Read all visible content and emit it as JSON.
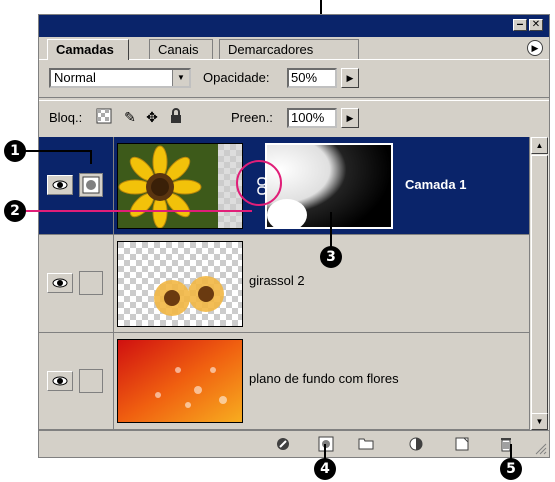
{
  "tabs": {
    "active": "Camadas",
    "t2": "Canais",
    "t3": "Demarcadores"
  },
  "window": {
    "minimize": "‒",
    "close": "✕",
    "menu": "▶"
  },
  "blend": {
    "mode": "Normal",
    "opacity_label": "Opacidade:",
    "opacity_value": "50%"
  },
  "lock": {
    "label": "Bloq.:",
    "fill_label": "Preen.:",
    "fill_value": "100%"
  },
  "layers": [
    {
      "name": "Camada 1",
      "selected": true
    },
    {
      "name": "girassol 2",
      "selected": false
    },
    {
      "name": "plano de fundo com flores",
      "selected": false
    }
  ],
  "callouts": {
    "c1": "1",
    "c2": "2",
    "c3": "3",
    "c4": "4",
    "c5": "5"
  },
  "colors": {
    "selection": "#0a246a",
    "panel": "#d4d0c8",
    "highlight_circle": "#e01e78"
  }
}
